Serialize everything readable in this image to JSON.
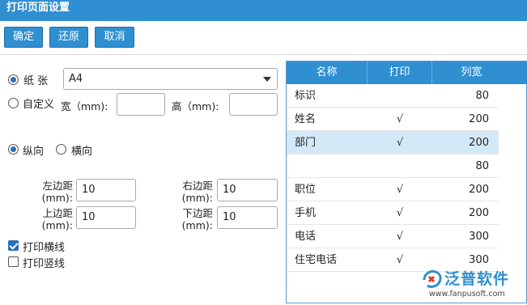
{
  "window": {
    "title": "打印页面设置"
  },
  "toolbar": {
    "confirm_label": "确定",
    "restore_label": "还原",
    "cancel_label": "取消"
  },
  "paper": {
    "paper_label": "纸 张",
    "selected_size": "A4",
    "custom_label": "自定义",
    "width_label": "宽（mm):",
    "height_label": "高（mm):",
    "width_value": "",
    "height_value": ""
  },
  "orientation": {
    "portrait_label": "纵向",
    "landscape_label": "横向"
  },
  "margins": {
    "left_label": "左边距",
    "right_label": "右边距",
    "top_label": "上边距",
    "bottom_label": "下边距",
    "unit_label": "(mm):",
    "left_value": "10",
    "right_value": "10",
    "top_value": "10",
    "bottom_value": "10"
  },
  "lines": {
    "horizontal_label": "打印横线",
    "vertical_label": "打印竖线"
  },
  "columns_table": {
    "headers": {
      "name": "名称",
      "print": "打印",
      "width": "列宽"
    },
    "rows": [
      {
        "name": "标识",
        "print": "",
        "width": "80"
      },
      {
        "name": "姓名",
        "print": "√",
        "width": "200"
      },
      {
        "name": "部门",
        "print": "√",
        "width": "200"
      },
      {
        "name": "",
        "print": "",
        "width": "80"
      },
      {
        "name": "职位",
        "print": "√",
        "width": "200"
      },
      {
        "name": "手机",
        "print": "√",
        "width": "200"
      },
      {
        "name": "电话",
        "print": "√",
        "width": "300"
      },
      {
        "name": "住宅电话",
        "print": "√",
        "width": "300"
      }
    ]
  },
  "watermark": {
    "brand_name": "泛普软件",
    "url": "www.fanpusoft.com",
    "accent_color": "#2f8fd0",
    "mark_color": "#e0392b"
  }
}
